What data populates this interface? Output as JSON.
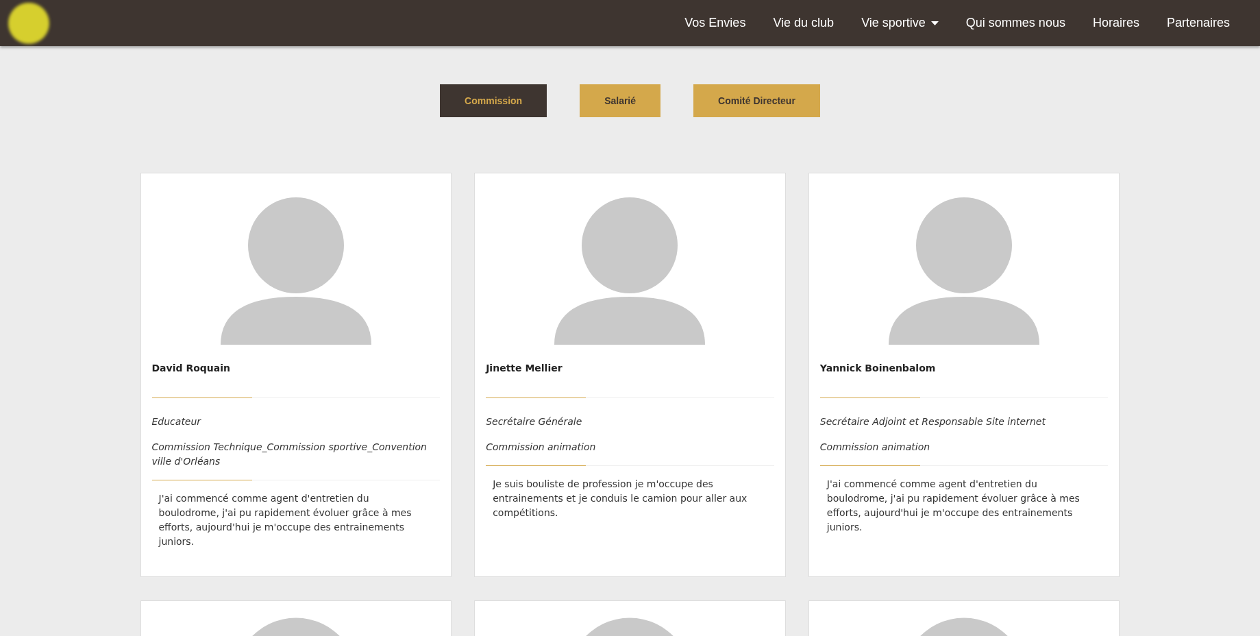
{
  "navbar": {
    "items": [
      {
        "label": "Vos Envies",
        "has_dropdown": false
      },
      {
        "label": "Vie du club",
        "has_dropdown": false
      },
      {
        "label": "Vie sportive",
        "has_dropdown": true
      },
      {
        "label": "Qui sommes nous",
        "has_dropdown": false
      },
      {
        "label": "Horaires",
        "has_dropdown": false
      },
      {
        "label": "Partenaires",
        "has_dropdown": false
      }
    ]
  },
  "filters": [
    {
      "label": "Commission",
      "selected": true
    },
    {
      "label": "Salarié",
      "selected": false
    },
    {
      "label": "Comité Directeur",
      "selected": false
    }
  ],
  "members": [
    {
      "name": "David Roquain",
      "role": "Educateur",
      "commissions": "Commission Technique_Commission sportive_Convention ville d'Orléans",
      "bio": "J'ai commencé comme agent d'entretien du boulodrome, j'ai pu rapidement évoluer grâce à mes efforts, aujourd'hui je m'occupe des entrainements juniors."
    },
    {
      "name": "Jinette Mellier",
      "role": "Secrétaire Générale",
      "commissions": "Commission animation",
      "bio": "Je suis bouliste de profession je m'occupe des entrainements et je conduis le camion pour aller aux compétitions."
    },
    {
      "name": "Yannick Boinenbalom",
      "role": "Secrétaire Adjoint et Responsable Site internet",
      "commissions": "Commission animation",
      "bio": "J'ai commencé comme agent d'entretien du boulodrome, j'ai pu rapidement évoluer grâce à mes efforts, aujourd'hui je m'occupe des entrainements juniors."
    }
  ],
  "next_row": [
    {
      "kind": "avatar"
    },
    {
      "kind": "avatar"
    },
    {
      "kind": "avatar"
    }
  ]
}
